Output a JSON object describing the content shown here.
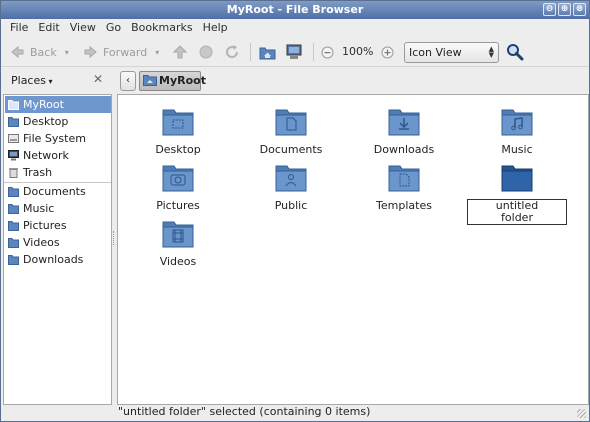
{
  "window": {
    "title": "MyRoot - File Browser",
    "buttons": [
      "⊖",
      "⊕",
      "⊗"
    ]
  },
  "menubar": {
    "items": [
      "File",
      "Edit",
      "View",
      "Go",
      "Bookmarks",
      "Help"
    ]
  },
  "toolbar": {
    "back_label": "Back",
    "forward_label": "Forward",
    "zoom_level": "100%",
    "view_mode": "Icon View"
  },
  "locationbar": {
    "places_label": "Places",
    "crumb_label": "MyRoot"
  },
  "sidebar": {
    "items": [
      {
        "label": "MyRoot",
        "icon": "folder-home-icon"
      },
      {
        "label": "Desktop",
        "icon": "folder-icon"
      },
      {
        "label": "File System",
        "icon": "drive-icon"
      },
      {
        "label": "Network",
        "icon": "network-icon"
      },
      {
        "label": "Trash",
        "icon": "trash-icon"
      },
      {
        "label": "Documents",
        "icon": "folder-icon"
      },
      {
        "label": "Music",
        "icon": "folder-icon"
      },
      {
        "label": "Pictures",
        "icon": "folder-icon"
      },
      {
        "label": "Videos",
        "icon": "folder-icon"
      },
      {
        "label": "Downloads",
        "icon": "folder-icon"
      }
    ]
  },
  "files": [
    {
      "name": "Desktop",
      "emblem": "desktop"
    },
    {
      "name": "Documents",
      "emblem": "documents"
    },
    {
      "name": "Downloads",
      "emblem": "downloads"
    },
    {
      "name": "Music",
      "emblem": "music"
    },
    {
      "name": "Pictures",
      "emblem": "pictures"
    },
    {
      "name": "Public",
      "emblem": "public"
    },
    {
      "name": "Templates",
      "emblem": "templates"
    },
    {
      "name": "untitled folder",
      "emblem": "none"
    },
    {
      "name": "Videos",
      "emblem": "videos"
    }
  ],
  "status": {
    "text": "\"untitled folder\" selected (containing 0 items)"
  },
  "colors": {
    "selection": "#6f97cf",
    "titlebar": "#5d7cb0",
    "folder": "#5b86bd"
  }
}
